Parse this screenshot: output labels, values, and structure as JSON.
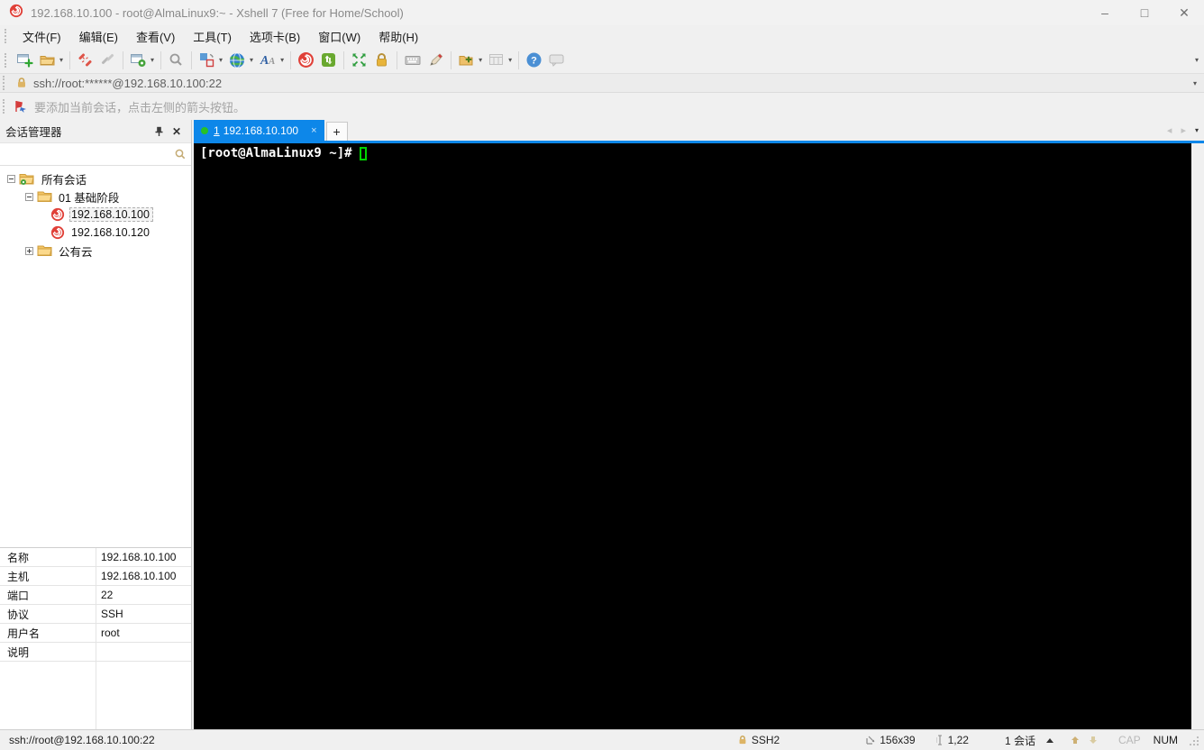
{
  "window": {
    "title": "192.168.10.100 - root@AlmaLinux9:~ - Xshell 7 (Free for Home/School)",
    "controls": {
      "minimize": "–",
      "maximize": "□",
      "close": "✕"
    }
  },
  "menu": {
    "items": [
      "文件(F)",
      "编辑(E)",
      "查看(V)",
      "工具(T)",
      "选项卡(B)",
      "窗口(W)",
      "帮助(H)"
    ]
  },
  "toolbar": {
    "icons": [
      "new-session",
      "open-session-folder",
      "disconnect",
      "reconnect",
      "session-properties",
      "find",
      "compose-pane",
      "web-browser",
      "fonts",
      "xshell",
      "xftp",
      "fullscreen",
      "lock-screen",
      "virtual-keyboard",
      "highlight-pen",
      "new-session-folder",
      "layout-grid",
      "help",
      "feedback"
    ]
  },
  "address_bar": {
    "value": "ssh://root:******@192.168.10.100:22"
  },
  "info_bar": {
    "text": "要添加当前会话，点击左侧的箭头按钮。"
  },
  "session_manager": {
    "title": "会话管理器",
    "search_placeholder": "",
    "tree": [
      {
        "label": "所有会话",
        "type": "root-folder"
      },
      {
        "label": "01 基础阶段",
        "type": "folder"
      },
      {
        "label": "192.168.10.100",
        "type": "session",
        "selected": true
      },
      {
        "label": "192.168.10.120",
        "type": "session"
      },
      {
        "label": "公有云",
        "type": "folder-collapsed"
      }
    ]
  },
  "properties": {
    "rows": [
      {
        "label": "名称",
        "value": "192.168.10.100"
      },
      {
        "label": "主机",
        "value": "192.168.10.100"
      },
      {
        "label": "端口",
        "value": "22"
      },
      {
        "label": "协议",
        "value": "SSH"
      },
      {
        "label": "用户名",
        "value": "root"
      },
      {
        "label": "说明",
        "value": ""
      }
    ]
  },
  "tabs": {
    "active_index": "1",
    "active_label": "192.168.10.100",
    "close_glyph": "×",
    "new_tab_label": "+"
  },
  "terminal": {
    "prompt": "[root@AlmaLinux9 ~]#"
  },
  "status_bar": {
    "left": "ssh://root@192.168.10.100:22",
    "protocol": "SSH2",
    "size": "156x39",
    "cursor_pos": "1,22",
    "sessions": "1 会话",
    "cap": "CAP",
    "num": "NUM"
  },
  "colors": {
    "accent_blue": "#0d87e9",
    "xshell_red": "#e04038",
    "terminal_bg": "#000000",
    "cursor_green": "#00d300",
    "tab_dot_green": "#27c127"
  }
}
